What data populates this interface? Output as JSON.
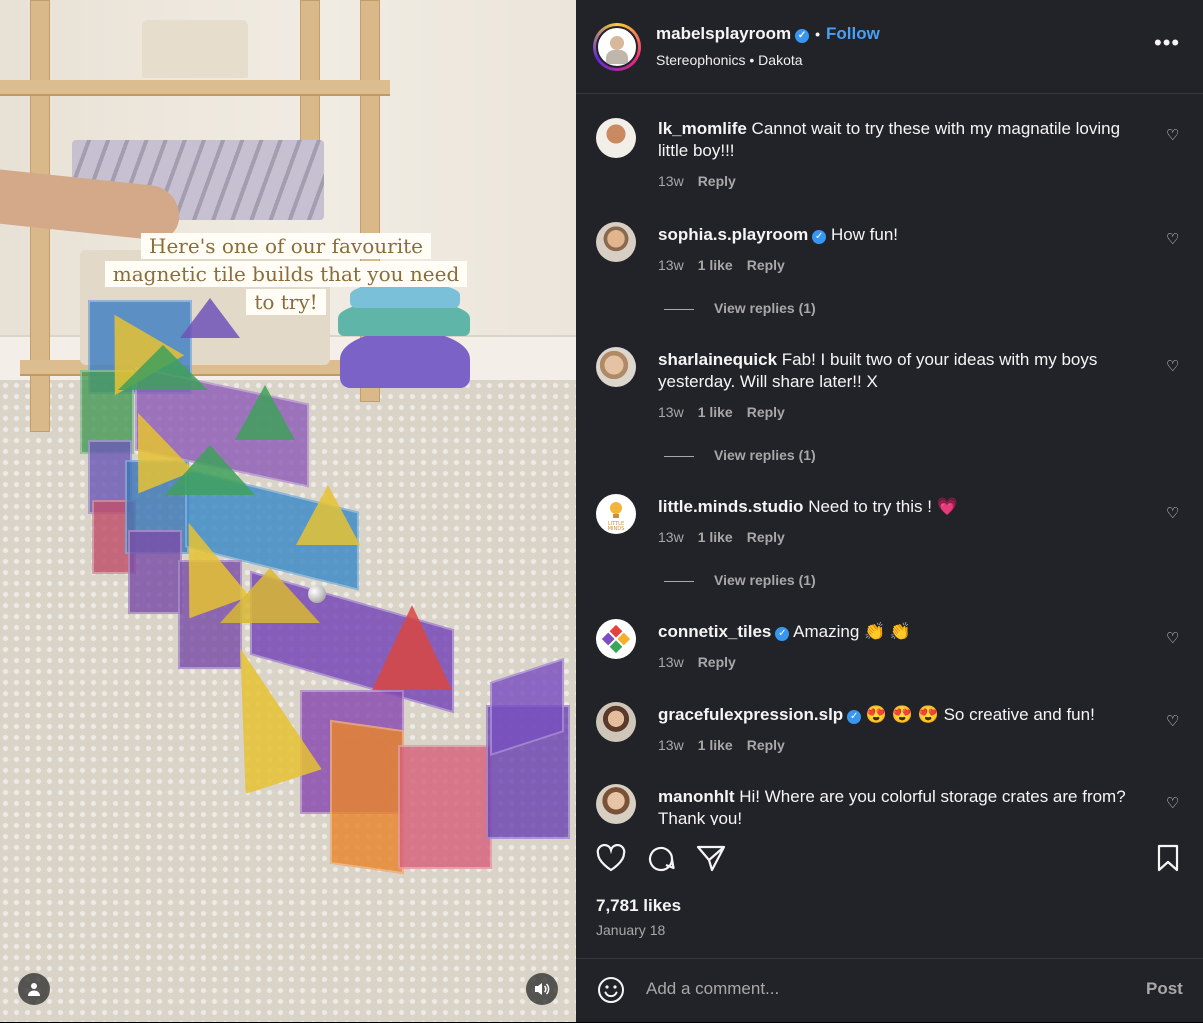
{
  "media": {
    "caption": "Here's one of our favourite magnetic tile builds that you need to try!"
  },
  "header": {
    "username": "mabelsplayroom",
    "follow": "Follow",
    "song": "Stereophonics • Dakota",
    "more": "•••"
  },
  "comments": [
    {
      "user": "lk_momlife",
      "verified": false,
      "text": "Cannot wait to try these with my magnatile loving little boy!!!",
      "time": "13w",
      "likes": "",
      "reply": "Reply",
      "view_replies": ""
    },
    {
      "user": "sophia.s.playroom",
      "verified": true,
      "text": "How fun!",
      "time": "13w",
      "likes": "1 like",
      "reply": "Reply",
      "view_replies": "View replies (1)"
    },
    {
      "user": "sharlainequick",
      "verified": false,
      "text": "Fab! I built two of your ideas with my boys yesterday. Will share later!! X",
      "time": "13w",
      "likes": "1 like",
      "reply": "Reply",
      "view_replies": "View replies (1)"
    },
    {
      "user": "little.minds.studio",
      "verified": false,
      "text": "Need to try this ! 💗",
      "time": "13w",
      "likes": "1 like",
      "reply": "Reply",
      "view_replies": "View replies (1)"
    },
    {
      "user": "connetix_tiles",
      "verified": true,
      "text": "Amazing 👏 👏",
      "time": "13w",
      "likes": "",
      "reply": "Reply",
      "view_replies": ""
    },
    {
      "user": "gracefulexpression.slp",
      "verified": true,
      "text": "😍 😍 😍 So creative and fun!",
      "time": "13w",
      "likes": "1 like",
      "reply": "Reply",
      "view_replies": ""
    },
    {
      "user": "manonhlt",
      "verified": false,
      "text": "Hi! Where are you colorful storage crates are from? Thank you!",
      "time": "",
      "likes": "",
      "reply": "",
      "view_replies": ""
    }
  ],
  "likes": "7,781 likes",
  "date": "January 18",
  "add_comment": {
    "placeholder": "Add a comment...",
    "post": "Post"
  },
  "colors": {
    "panel_bg": "#212328",
    "link": "#4a9ff5",
    "verified": "#3797f0",
    "muted": "#a8a8a8"
  },
  "icons": [
    "heart-icon",
    "comment-icon",
    "share-icon",
    "bookmark-icon",
    "emoji-icon",
    "user-tag-icon",
    "volume-icon",
    "more-icon"
  ]
}
